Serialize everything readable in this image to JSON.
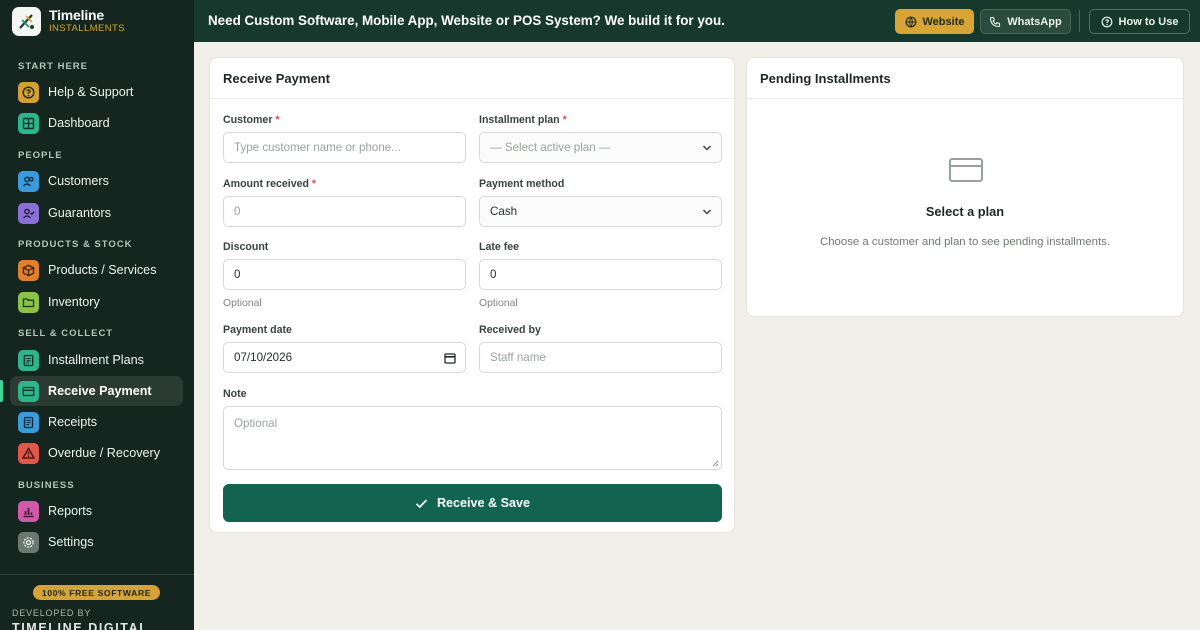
{
  "brand": {
    "title": "Timeline",
    "subtitle": "INSTALLMENTS"
  },
  "topbar": {
    "promo": "Need Custom Software, Mobile App, Website or POS System? We build it for you.",
    "website": "Website",
    "whatsapp": "WhatsApp",
    "how_to": "How to Use"
  },
  "sidebar": {
    "sections": {
      "start": "START HERE",
      "people": "PEOPLE",
      "products": "PRODUCTS & STOCK",
      "sell": "SELL & COLLECT",
      "business": "BUSINESS"
    },
    "items": [
      {
        "label": "Help & Support",
        "icon": "help-circle-icon",
        "color": "#d4a032"
      },
      {
        "label": "Dashboard",
        "icon": "dashboard-grid-icon",
        "color": "#2fb48c"
      },
      {
        "label": "Customers",
        "icon": "users-icon",
        "color": "#3b9ad9"
      },
      {
        "label": "Guarantors",
        "icon": "user-check-icon",
        "color": "#8a6fd6"
      },
      {
        "label": "Products / Services",
        "icon": "box-icon",
        "color": "#e07f2c"
      },
      {
        "label": "Inventory",
        "icon": "folder-icon",
        "color": "#8bc34a"
      },
      {
        "label": "Installment Plans",
        "icon": "calendar-file-icon",
        "color": "#2fb48c"
      },
      {
        "label": "Receive Payment",
        "icon": "credit-card-icon",
        "color": "#2fb48c"
      },
      {
        "label": "Receipts",
        "icon": "receipt-icon",
        "color": "#3b9ad9"
      },
      {
        "label": "Overdue / Recovery",
        "icon": "warning-triangle-icon",
        "color": "#e0584a"
      },
      {
        "label": "Reports",
        "icon": "bar-chart-icon",
        "color": "#d05aa8"
      },
      {
        "label": "Settings",
        "icon": "gear-icon",
        "color": "#6b7771"
      }
    ],
    "free_badge": "100% FREE SOFTWARE",
    "developed_by": "DEVELOPED BY",
    "developer": "TIMELINE DIGITAL"
  },
  "receive": {
    "title": "Receive Payment",
    "customer_label": "Customer",
    "customer_placeholder": "Type customer name or phone...",
    "plan_label": "Installment plan",
    "plan_selected": "— Select active plan —",
    "amount_label": "Amount received",
    "amount_placeholder": "0",
    "method_label": "Payment method",
    "method_selected": "Cash",
    "discount_label": "Discount",
    "discount_value": "0",
    "discount_hint": "Optional",
    "latefee_label": "Late fee",
    "latefee_value": "0",
    "latefee_hint": "Optional",
    "date_label": "Payment date",
    "date_value": "07/10/2026",
    "received_by_label": "Received by",
    "received_by_placeholder": "Staff name",
    "note_label": "Note",
    "note_placeholder": "Optional",
    "submit": "Receive & Save",
    "required_mark": "*"
  },
  "pending": {
    "title": "Pending Installments",
    "empty_title": "Select a plan",
    "empty_desc": "Choose a customer and plan to see pending installments."
  }
}
